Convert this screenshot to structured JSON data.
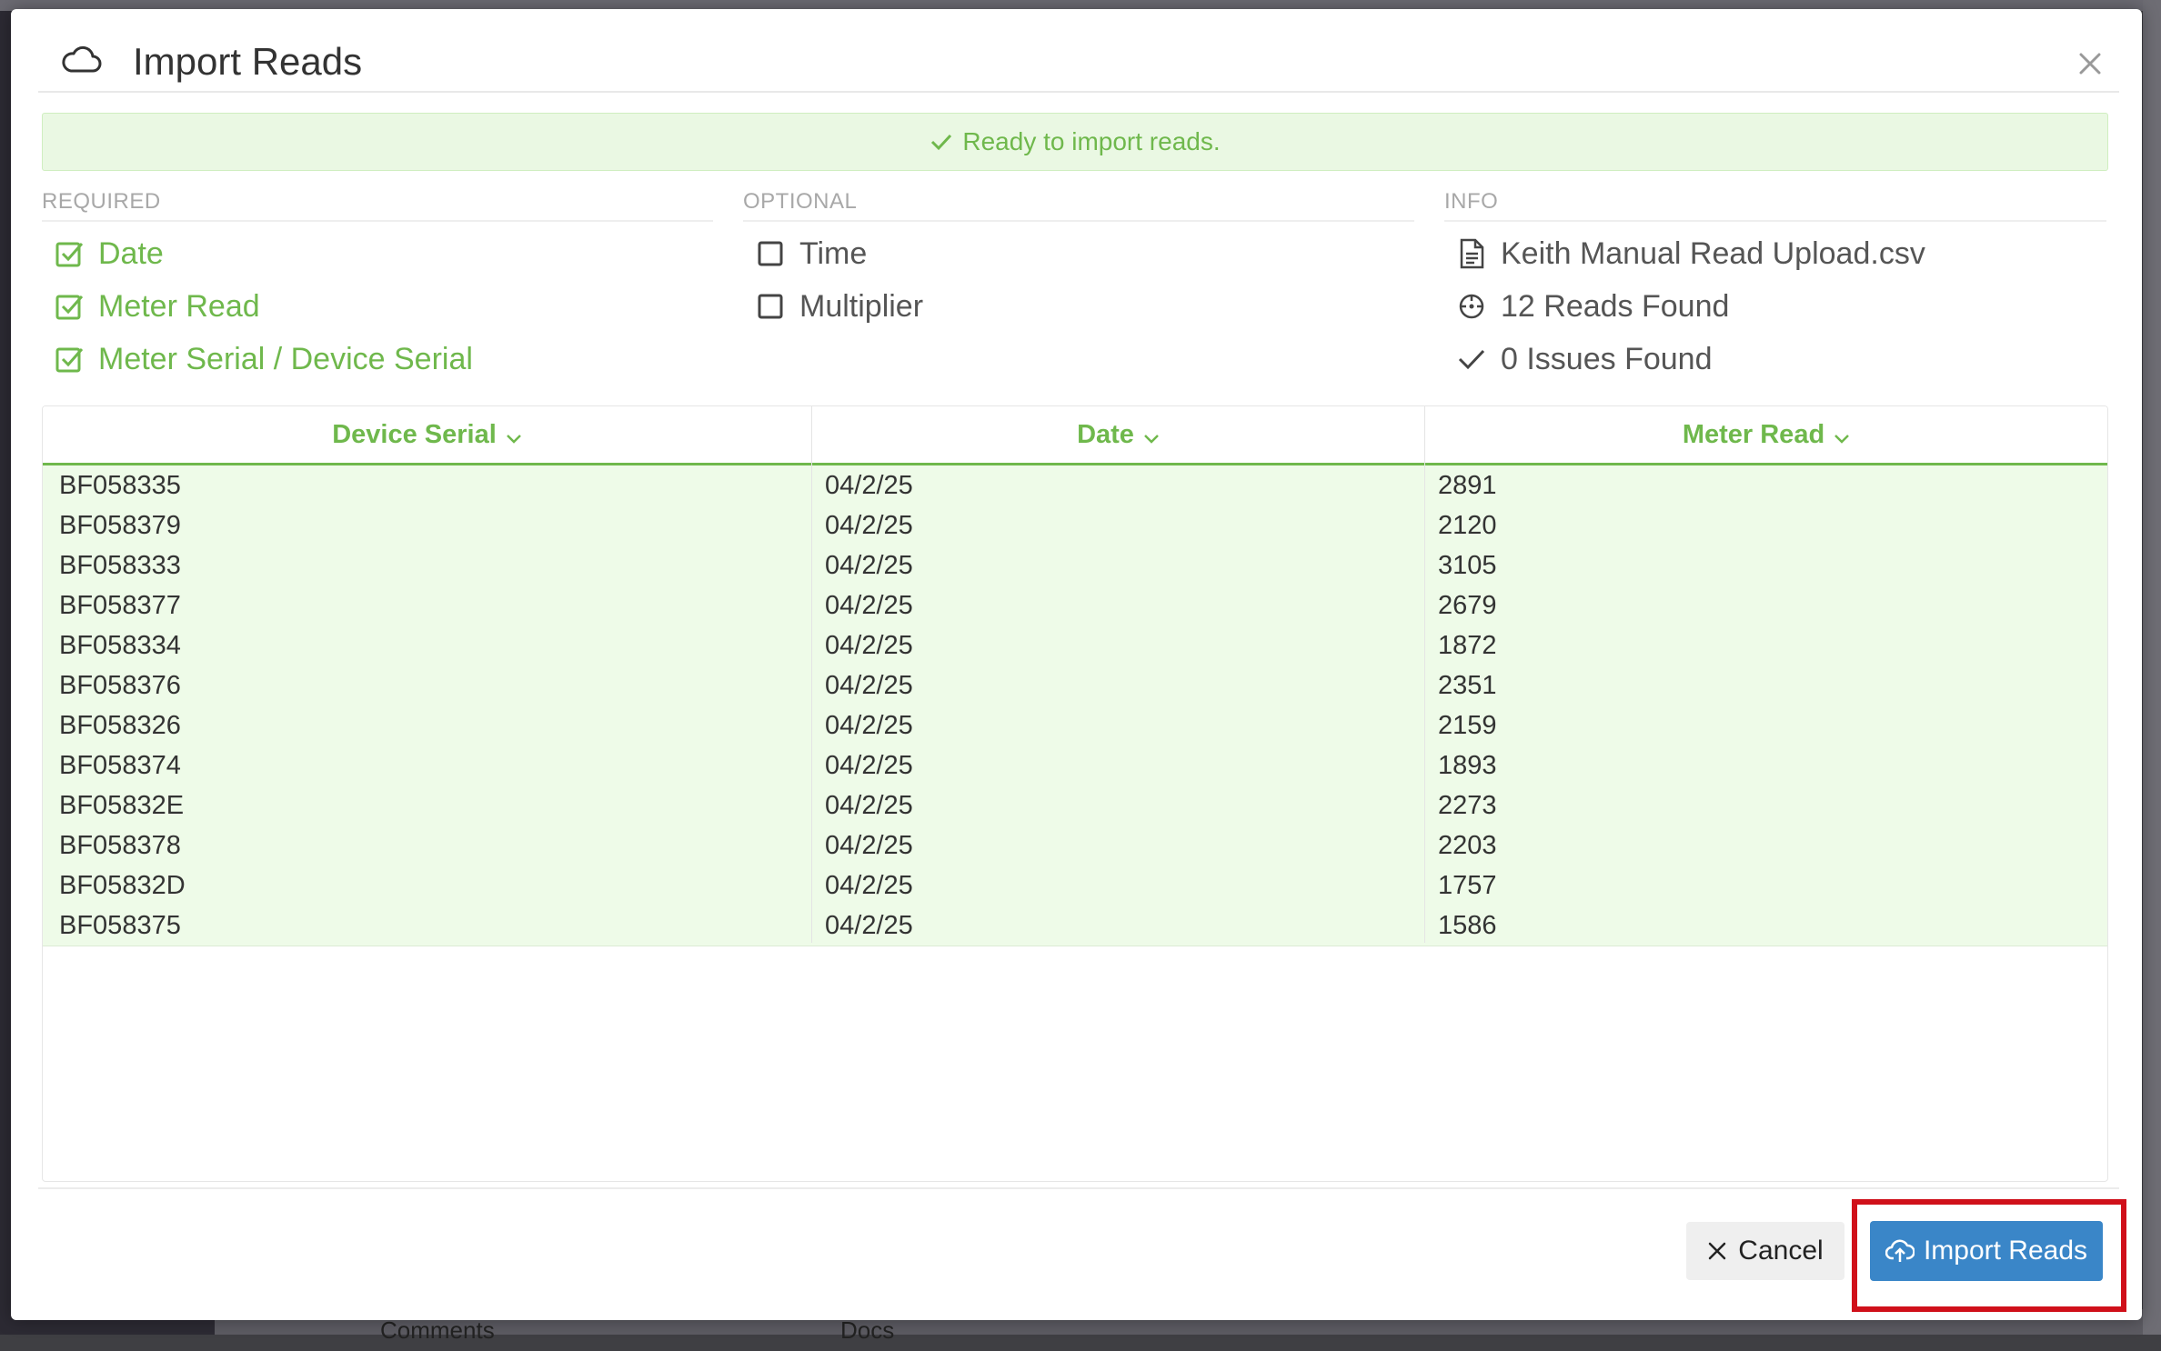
{
  "modal": {
    "title": "Import Reads",
    "banner": "Ready to import reads."
  },
  "required": {
    "heading": "REQUIRED",
    "fields": [
      "Date",
      "Meter Read",
      "Meter Serial / Device Serial"
    ]
  },
  "optional": {
    "heading": "OPTIONAL",
    "fields": [
      "Time",
      "Multiplier"
    ]
  },
  "info": {
    "heading": "INFO",
    "file_name": "Keith Manual Read Upload.csv",
    "reads_found": "12 Reads Found",
    "issues_found": "0 Issues Found"
  },
  "table": {
    "columns": [
      "Device Serial",
      "Date",
      "Meter Read"
    ],
    "rows": [
      [
        "BF058335",
        "04/2/25",
        "2891"
      ],
      [
        "BF058379",
        "04/2/25",
        "2120"
      ],
      [
        "BF058333",
        "04/2/25",
        "3105"
      ],
      [
        "BF058377",
        "04/2/25",
        "2679"
      ],
      [
        "BF058334",
        "04/2/25",
        "1872"
      ],
      [
        "BF058376",
        "04/2/25",
        "2351"
      ],
      [
        "BF058326",
        "04/2/25",
        "2159"
      ],
      [
        "BF058374",
        "04/2/25",
        "1893"
      ],
      [
        "BF05832E",
        "04/2/25",
        "2273"
      ],
      [
        "BF058378",
        "04/2/25",
        "2203"
      ],
      [
        "BF05832D",
        "04/2/25",
        "1757"
      ],
      [
        "BF058375",
        "04/2/25",
        "1586"
      ]
    ]
  },
  "buttons": {
    "cancel": "Cancel",
    "import": "Import Reads"
  },
  "background": {
    "tab_comments": "Comments",
    "tab_docs": "Docs"
  },
  "colors": {
    "accent_green": "#6fb84c",
    "primary_blue": "#3a86c8",
    "highlight_red": "#d0101a"
  }
}
